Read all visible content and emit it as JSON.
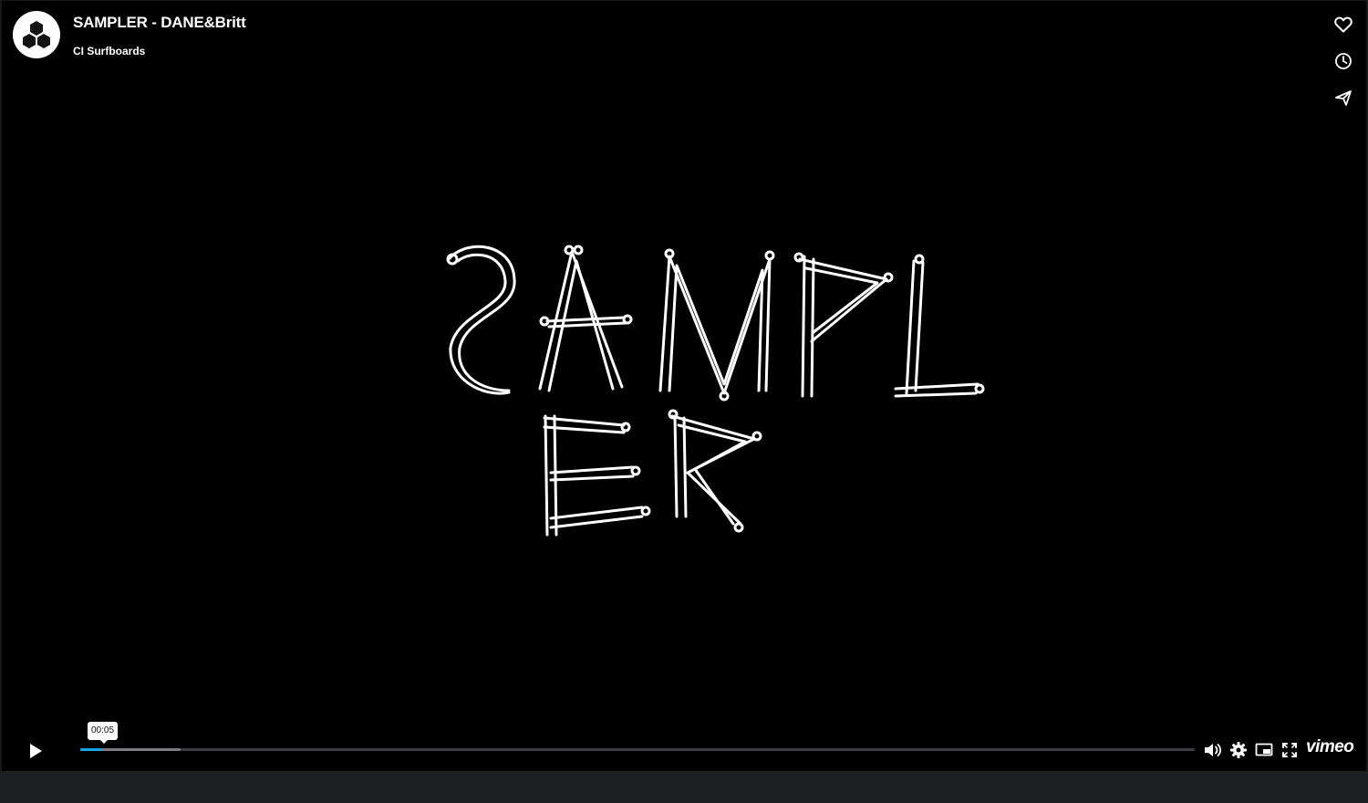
{
  "video": {
    "title": "SAMPLER - DANE&Britt",
    "channel": "CI Surfboards"
  },
  "actions": [
    {
      "name": "like-button",
      "icon": "heart-icon"
    },
    {
      "name": "watch-later-button",
      "icon": "clock-icon"
    },
    {
      "name": "share-button",
      "icon": "paper-plane-icon"
    }
  ],
  "controls": {
    "current_time": "00:05",
    "played_fraction": 0.02,
    "buffered_fraction": 0.09,
    "brand_label": "vimeo",
    "accent_color": "#17a5e8"
  }
}
